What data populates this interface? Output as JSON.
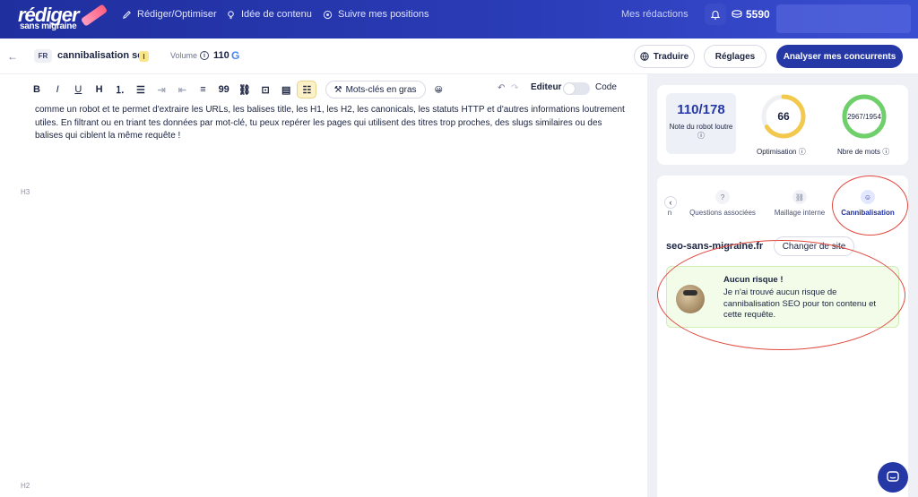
{
  "nav": {
    "logo_top": "rédiger",
    "logo_bottom": "sans migraine",
    "items": [
      {
        "label": "Rédiger/Optimiser",
        "icon": "pencil-icon"
      },
      {
        "label": "Idée de contenu",
        "icon": "lightbulb-icon"
      },
      {
        "label": "Suivre mes positions",
        "icon": "target-icon"
      }
    ],
    "my_drafts": "Mes rédactions",
    "credits": "5590"
  },
  "subbar": {
    "lang": "FR",
    "keyword": "cannibalisation seo",
    "keyword_badge": "I",
    "volume_label": "Volume",
    "volume_value": "110",
    "translate": "Traduire",
    "settings": "Réglages",
    "analyze": "Analyser mes concurrents"
  },
  "toolbar": {
    "bold": "B",
    "italic": "I",
    "underline": "U",
    "heading": "H",
    "quote": "99",
    "bold_keywords": "Mots-clés en gras",
    "editor": "Editeur",
    "code": "Code"
  },
  "editor": {
    "paragraph": "comme un robot et te permet d'extraire les URLs, les balises title, les H1, les H2, les canonicals, les statuts HTTP et d'autres informations loutrement utiles. En filtrant ou en triant tes données par mot-clé, tu peux repérer les pages qui utilisent des titres trop proches, des slugs similaires ou des balises qui ciblent la même requête !",
    "h3_tag": "H3",
    "h2_tag": "H2"
  },
  "scores": {
    "note_value": "110/178",
    "note_label": "Note du robot loutre",
    "optimisation_value": "66",
    "optimisation_fraction": 0.66,
    "optimisation_label": "Optimisation",
    "words_value": "2967/1954",
    "words_fraction": 1.0,
    "words_label": "Nbre de mots",
    "colors": {
      "optimisation": "#f2c94c",
      "words": "#6fcf6a"
    }
  },
  "analysis": {
    "tabs": [
      {
        "label": "n",
        "icon": "list-icon"
      },
      {
        "label": "Questions associées",
        "icon": "question-icon"
      },
      {
        "label": "Maillage interne",
        "icon": "link-icon"
      },
      {
        "label": "Cannibalisation",
        "icon": "robot-icon"
      }
    ],
    "site": "seo-sans-migraine.fr",
    "change_site": "Changer de site",
    "risk_title": "Aucun risque !",
    "risk_text": "Je n'ai trouvé aucun risque de cannibalisation SEO pour ton contenu et cette requête."
  }
}
